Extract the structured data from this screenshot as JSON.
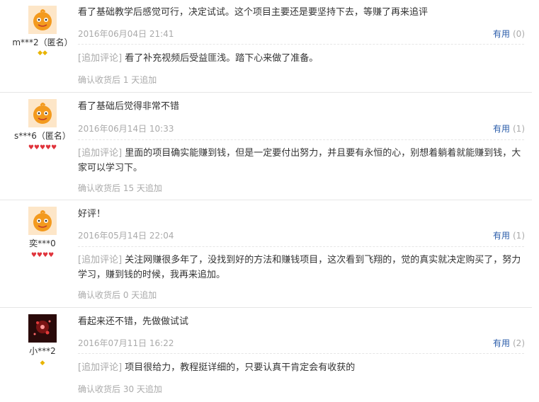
{
  "reviews": [
    {
      "user": "m***2（匿名）",
      "badge_icon": "diamond-badge",
      "badge_count": 2,
      "text": "看了基础教学后感觉可行，决定试试。这个项目主要还是要坚持下去，等赚了再来追评",
      "date": "2016年06月04日 21:41",
      "useful_label": "有用",
      "useful_count": "(0)",
      "append_tag": "[追加评论]",
      "append_text": "看了补充视频后受益匪浅。踏下心来做了准备。",
      "confirm": "确认收货后 1 天追加"
    },
    {
      "user": "s***6（匿名）",
      "badge_icon": "heart-badge",
      "badge_count": 5,
      "text": "看了基础后觉得非常不错",
      "date": "2016年06月14日 10:33",
      "useful_label": "有用",
      "useful_count": "(1)",
      "append_tag": "[追加评论]",
      "append_text": "里面的项目确实能赚到钱，但是一定要付出努力，并且要有永恒的心，别想着躺着就能赚到钱，大家可以学习下。",
      "confirm": "确认收货后 15 天追加"
    },
    {
      "user": "奕***0",
      "badge_icon": "heart-badge",
      "badge_count": 4,
      "text": "好评！",
      "date": "2016年05月14日 22:04",
      "useful_label": "有用",
      "useful_count": "(1)",
      "append_tag": "[追加评论]",
      "append_text": "关注网赚很多年了，没找到好的方法和赚钱项目，这次看到飞翔的，觉的真实就决定购买了，努力学习，赚到钱的时候，我再来追加。",
      "confirm": "确认收货后 0 天追加"
    },
    {
      "user": "小***2",
      "badge_icon": "diamond-badge",
      "badge_count": 1,
      "text": "看起来还不错，先做做试试",
      "date": "2016年07月11日 16:22",
      "useful_label": "有用",
      "useful_count": "(2)",
      "append_tag": "[追加评论]",
      "append_text": "项目很给力，教程挺详细的，只要认真干肯定会有收获的",
      "confirm": "确认收货后 30 天追加"
    }
  ]
}
